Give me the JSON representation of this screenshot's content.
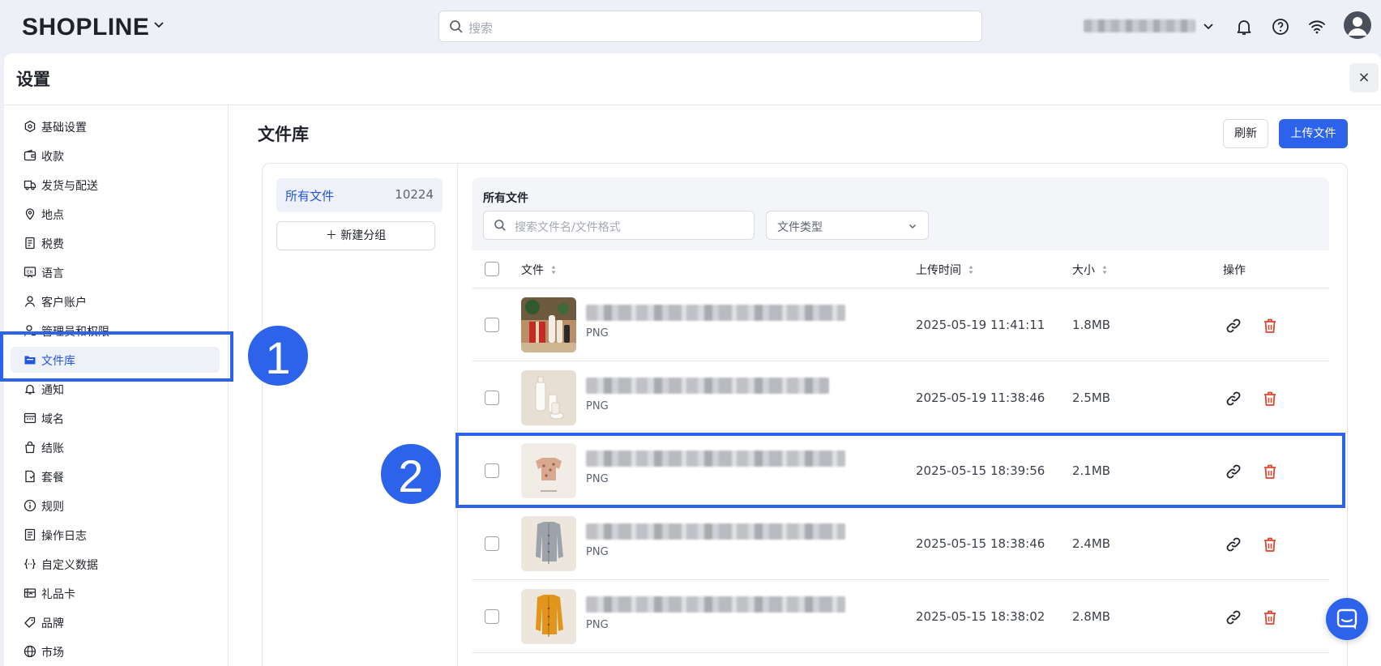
{
  "topbar": {
    "logo": "SHOPLINE",
    "search_placeholder": "搜索"
  },
  "panel": {
    "title": "设置",
    "close_label": "×"
  },
  "sidebar": {
    "items": [
      {
        "label": "基础设置",
        "icon": "hexagon-settings-icon"
      },
      {
        "label": "收款",
        "icon": "wallet-icon"
      },
      {
        "label": "发货与配送",
        "icon": "truck-icon"
      },
      {
        "label": "地点",
        "icon": "location-pin-icon"
      },
      {
        "label": "税费",
        "icon": "tax-receipt-icon"
      },
      {
        "label": "语言",
        "icon": "language-icon"
      },
      {
        "label": "客户账户",
        "icon": "user-icon"
      },
      {
        "label": "管理员和权限",
        "icon": "admin-user-icon"
      },
      {
        "label": "文件库",
        "icon": "folder-icon",
        "active": true
      },
      {
        "label": "通知",
        "icon": "bell-icon"
      },
      {
        "label": "域名",
        "icon": "domain-icon"
      },
      {
        "label": "结账",
        "icon": "shopping-bag-icon"
      },
      {
        "label": "套餐",
        "icon": "plan-icon"
      },
      {
        "label": "规则",
        "icon": "info-icon"
      },
      {
        "label": "操作日志",
        "icon": "log-icon"
      },
      {
        "label": "自定义数据",
        "icon": "code-braces-icon"
      },
      {
        "label": "礼品卡",
        "icon": "gift-card-icon"
      },
      {
        "label": "品牌",
        "icon": "brand-tag-icon"
      },
      {
        "label": "市场",
        "icon": "globe-icon"
      }
    ]
  },
  "content": {
    "title": "文件库",
    "refresh_label": "刷新",
    "upload_label": "上传文件"
  },
  "groups": {
    "all_files_label": "所有文件",
    "all_files_count": "10224",
    "new_group_label": "＋ 新建分组"
  },
  "filters": {
    "title": "所有文件",
    "search_placeholder": "搜索文件名/文件格式",
    "type_label": "文件类型"
  },
  "table": {
    "columns": {
      "file": "文件",
      "upload_time": "上传时间",
      "size": "大小",
      "actions": "操作"
    },
    "rows": [
      {
        "type": "PNG",
        "date": "2025-05-19 11:41:11",
        "size": "1.8MB",
        "thumb": "cosmetics-gift-thumbnail"
      },
      {
        "type": "PNG",
        "date": "2025-05-19 11:38:46",
        "size": "2.5MB",
        "thumb": "white-bottles-thumbnail"
      },
      {
        "type": "PNG",
        "date": "2025-05-15 18:39:56",
        "size": "2.1MB",
        "thumb": "floral-top-thumbnail"
      },
      {
        "type": "PNG",
        "date": "2025-05-15 18:38:46",
        "size": "2.4MB",
        "thumb": "grey-cardigan-thumbnail"
      },
      {
        "type": "PNG",
        "date": "2025-05-15 18:38:02",
        "size": "2.8MB",
        "thumb": "yellow-cardigan-thumbnail"
      }
    ]
  },
  "annotations": {
    "badge1": "1",
    "badge2": "2"
  },
  "colors": {
    "accent": "#2d62ea",
    "delete": "#e0452e"
  }
}
